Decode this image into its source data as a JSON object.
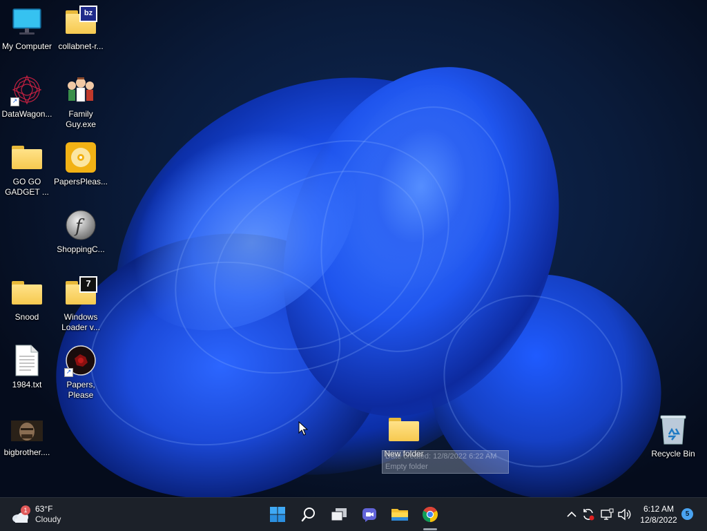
{
  "desktop_icons": [
    {
      "label": "My Computer",
      "icon": "monitor-icon"
    },
    {
      "label": "collabnet-r...",
      "icon": "zip-folder-icon",
      "badge": "bz"
    },
    {
      "label": "DataWagon...",
      "icon": "starburst-icon",
      "shortcut": true
    },
    {
      "label": "Family Guy.exe",
      "icon": "family-guy-icon"
    },
    {
      "label": "GO GO GADGET ...",
      "icon": "folder-icon"
    },
    {
      "label": "PapersPleas...",
      "icon": "disc-icon"
    },
    {
      "label": "ShoppingC...",
      "icon": "flash-icon"
    },
    {
      "label": "Snood",
      "icon": "folder-icon"
    },
    {
      "label": "Windows Loader v...",
      "icon": "zip-folder-icon",
      "badge": "7"
    },
    {
      "label": "1984.txt",
      "icon": "text-file-icon"
    },
    {
      "label": "Papers, Please",
      "icon": "papers-please-icon",
      "shortcut": true
    },
    {
      "label": "bigbrother....",
      "icon": "image-thumbnail-icon"
    },
    {
      "label": "New folder",
      "icon": "folder-icon"
    },
    {
      "label": "Recycle Bin",
      "icon": "recycle-bin-icon"
    }
  ],
  "tooltip": {
    "line1": "Date created: 12/8/2022 6:22 AM",
    "line2": "Empty folder"
  },
  "taskbar": {
    "weather": {
      "temp": "63°F",
      "condition": "Cloudy",
      "badge": "1"
    },
    "apps": [
      "start-icon",
      "search-icon",
      "task-view-icon",
      "chat-icon",
      "file-explorer-icon",
      "chrome-icon"
    ],
    "tray": [
      "chevron-up-icon",
      "sync-icon",
      "network-icon",
      "volume-icon"
    ],
    "clock": {
      "time": "6:12 AM",
      "date": "12/8/2022"
    },
    "notifications": "5"
  },
  "colors": {
    "taskbar": "#1c2129",
    "accent": "#0078d4",
    "folder": "#f6c94f",
    "wallpaper_blue": "#1f55ee"
  }
}
